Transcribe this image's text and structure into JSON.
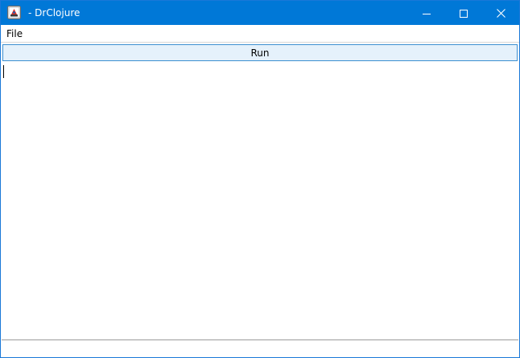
{
  "window": {
    "title": "- DrClojure",
    "app_icon": "java-app-icon",
    "controls": {
      "minimize_icon": "minimize-icon",
      "maximize_icon": "maximize-icon",
      "close_icon": "close-icon"
    }
  },
  "menubar": {
    "items": [
      {
        "label": "File"
      }
    ]
  },
  "toolbar": {
    "run_label": "Run"
  },
  "editor": {
    "content": ""
  },
  "repl": {
    "value": ""
  },
  "colors": {
    "titlebar": "#0078d7",
    "run_button_bg": "#e5f1fb",
    "run_button_border": "#3c8fd0"
  }
}
